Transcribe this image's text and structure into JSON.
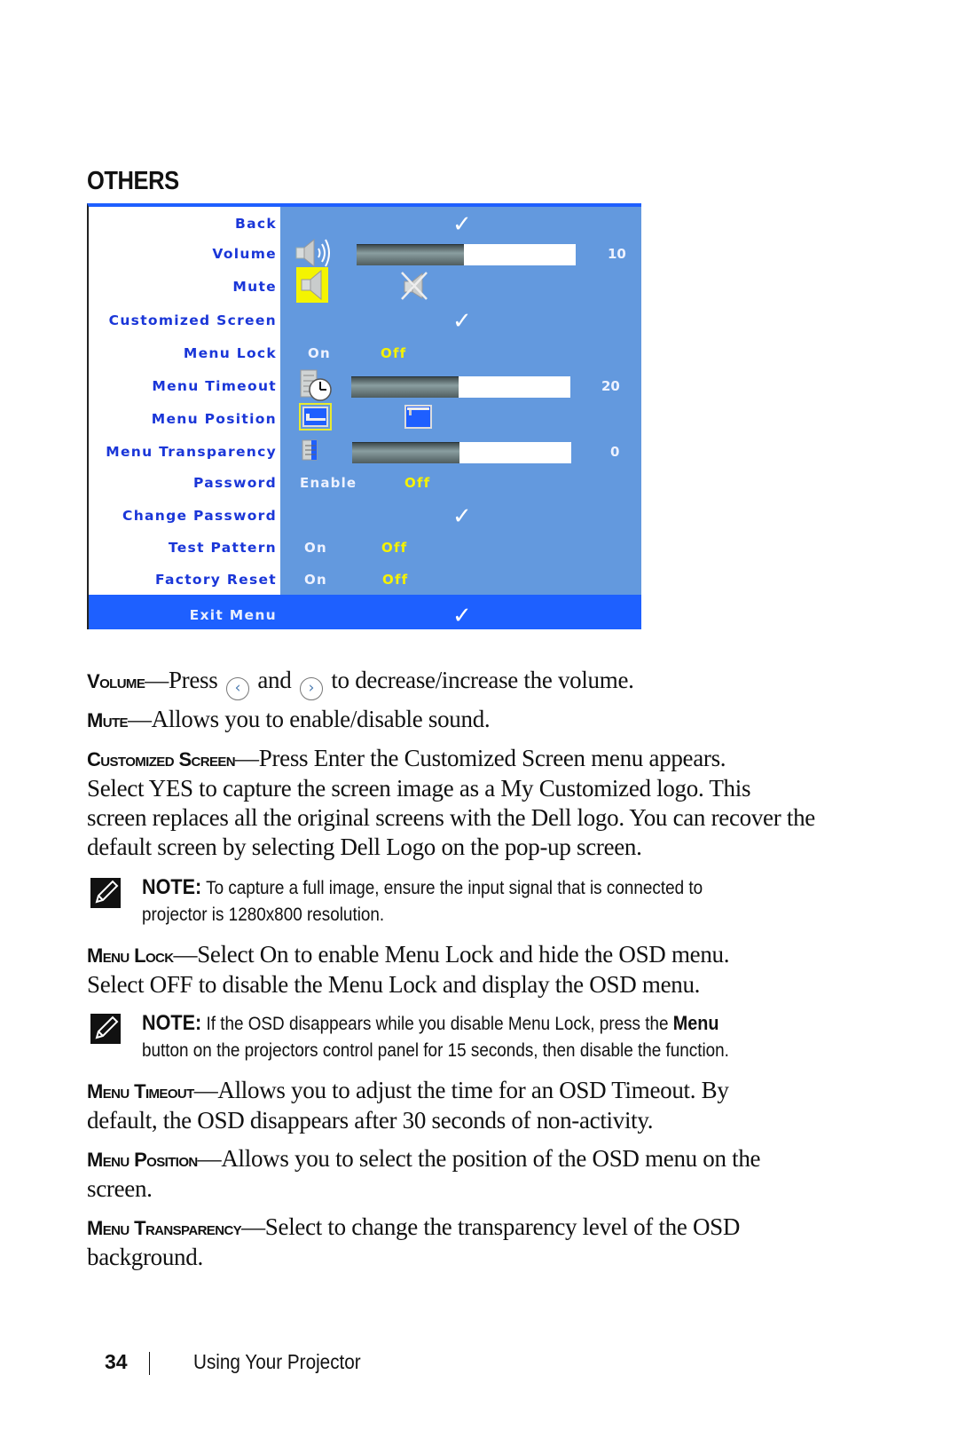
{
  "section_title": "OTHERS",
  "osd_menu": {
    "colors": {
      "panel": "#6399de",
      "label_bg": "#ffffff",
      "label_text": "#1a36d8",
      "selected_option": "#f6f200",
      "exit_row": "#1e60ff",
      "option_text": "#eef2ff"
    },
    "rows": [
      {
        "label": "Back",
        "control": "check",
        "icon": "checkmark-icon"
      },
      {
        "label": "Volume",
        "control": "slider",
        "icon": "speaker-icon",
        "value": "10",
        "fill_fraction": 0.49
      },
      {
        "label": "Mute",
        "control": "icons",
        "icon": "speaker-icon",
        "alt_icon": "muted-speaker-icon"
      },
      {
        "label": "Customized Screen",
        "control": "check",
        "icon": "checkmark-icon"
      },
      {
        "label": "Menu Lock",
        "control": "toggle",
        "options": [
          "On",
          "Off"
        ],
        "selected": "Off"
      },
      {
        "label": "Menu Timeout",
        "control": "slider",
        "icon": "menu-clock-icon",
        "value": "20",
        "fill_fraction": 0.49
      },
      {
        "label": "Menu Position",
        "control": "icons",
        "icon": "position-bottom-left-icon",
        "alt_icon": "position-top-left-icon"
      },
      {
        "label": "Menu Transparency",
        "control": "slider",
        "icon": "transparency-icon",
        "value": "0",
        "fill_fraction": 0.49
      },
      {
        "label": "Password",
        "control": "toggle",
        "options": [
          "Enable",
          "Off"
        ],
        "selected": "Off"
      },
      {
        "label": "Change Password",
        "control": "check",
        "icon": "checkmark-icon"
      },
      {
        "label": "Test Pattern",
        "control": "toggle",
        "options": [
          "On",
          "Off"
        ],
        "selected": "Off"
      },
      {
        "label": "Factory Reset",
        "control": "toggle",
        "options": [
          "On",
          "Off"
        ],
        "selected": "Off"
      },
      {
        "label": "Exit Menu",
        "control": "check",
        "icon": "checkmark-icon"
      }
    ],
    "check_glyph": "✓"
  },
  "body": {
    "volume": {
      "term": "Volume",
      "dash": "—",
      "t1": "Press ",
      "left_icon": "‹",
      "t2": " and ",
      "right_icon": "›",
      "t3": " to decrease/increase the volume."
    },
    "mute": {
      "term": "Mute",
      "dash": "—",
      "text": "Allows you to enable/disable sound."
    },
    "customized_screen": {
      "term": "Customized Screen",
      "dash": "—",
      "line1": "Press Enter the Customized Screen menu appears.",
      "line2": "Select YES to capture the screen image as a My Customized logo. This",
      "line3": "screen replaces all the original screens with the Dell logo. You can recover the",
      "line4": "default screen by selecting Dell Logo on the pop-up screen."
    },
    "note1": {
      "label": "NOTE:",
      "line1": " To capture a full image, ensure the input signal that is connected to",
      "line2": "projector is 1280x800 resolution."
    },
    "menu_lock": {
      "term": "Menu Lock",
      "dash": "—",
      "line1": "Select On to enable Menu Lock and hide the OSD menu.",
      "line2": "Select OFF to disable the Menu Lock and display the OSD menu."
    },
    "note2": {
      "label": "NOTE:",
      "line1a": " If the OSD disappears while you disable Menu Lock, press the ",
      "line1b": "Menu",
      "line2": "button on the projectors control panel for 15 seconds, then disable the function."
    },
    "menu_timeout": {
      "term": "Menu Timeout",
      "dash": "—",
      "line1": "Allows you to adjust the time for an OSD Timeout. By",
      "line2": "default, the OSD disappears after 30 seconds of non-activity."
    },
    "menu_position": {
      "term": "Menu Position",
      "dash": "—",
      "line1": "Allows you to select the position of the OSD menu on the",
      "line2": "screen."
    },
    "menu_transparency": {
      "term": "Menu Transparency",
      "dash": "—",
      "line1": "Select to change the transparency level of the OSD",
      "line2": "background."
    }
  },
  "footer": {
    "page_number": "34",
    "chapter": "Using Your Projector"
  }
}
